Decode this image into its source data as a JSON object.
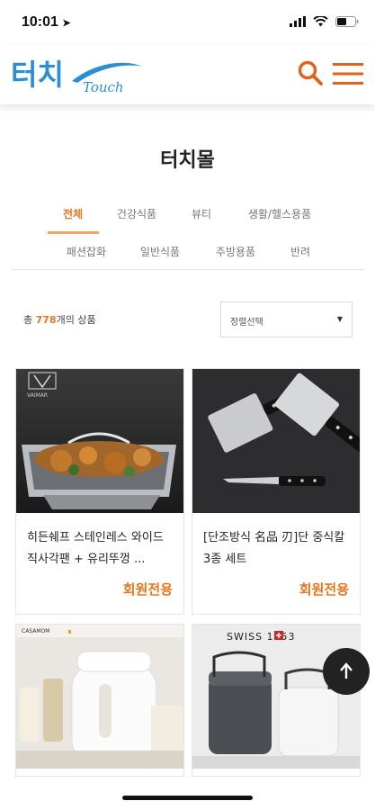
{
  "status_bar": {
    "time": "10:01"
  },
  "header": {
    "logo_text": "터치",
    "logo_sub": "Touch"
  },
  "page": {
    "title": "터치몰"
  },
  "categories": [
    {
      "label": "전체",
      "active": true
    },
    {
      "label": "건강식품",
      "active": false
    },
    {
      "label": "뷰티",
      "active": false
    },
    {
      "label": "생활/헬스용품",
      "active": false
    },
    {
      "label": "패션잡화",
      "active": false
    },
    {
      "label": "일반식품",
      "active": false
    },
    {
      "label": "주방용품",
      "active": false
    },
    {
      "label": "반려",
      "active": false
    }
  ],
  "listing": {
    "count_prefix": "총 ",
    "count": "778",
    "count_suffix": "개의 상품",
    "sort_placeholder": "정렬선택"
  },
  "products": [
    {
      "name": "히든쉐프 스테인레스 와이드 직사각팬 + 유리뚜껑 ...",
      "price": "회원전용",
      "brand": "VAIMAR"
    },
    {
      "name": "[단조방식 名品 刃]단 중식칼 3종 세트",
      "price": "회원전용"
    },
    {
      "name": "",
      "price": "",
      "brand": "CASAMOM"
    },
    {
      "name": "",
      "price": "",
      "brand": "SWISS 1753"
    }
  ],
  "colors": {
    "accent": "#e8761d",
    "logo_blue": "#2a8fd4"
  },
  "icons": {
    "search": "search-icon",
    "menu": "hamburger-menu-icon",
    "top": "arrow-up-icon"
  }
}
